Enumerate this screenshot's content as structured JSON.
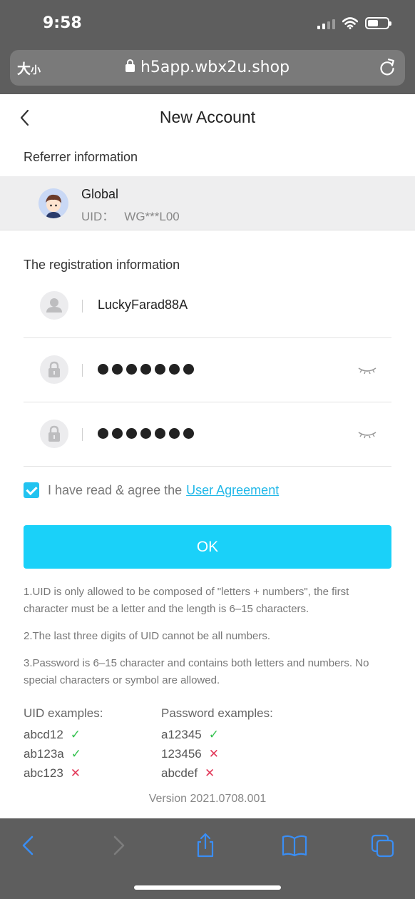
{
  "status_bar": {
    "time": "9:58"
  },
  "browser": {
    "text_size_label": "大",
    "text_size_small": "小",
    "url": "h5app.wbx2u.shop"
  },
  "header": {
    "title": "New Account"
  },
  "referrer": {
    "section_label": "Referrer information",
    "name": "Global",
    "uid_label": "UID：",
    "uid_value": "WG***L00"
  },
  "registration": {
    "section_label": "The registration information",
    "username_value": "LuckyFarad88A",
    "password_mask_count": 7,
    "confirm_mask_count": 7
  },
  "agreement": {
    "text": "I have read & agree the",
    "link": "User Agreement",
    "checked": true
  },
  "submit": {
    "label": "OK"
  },
  "rules": [
    "1.UID is only allowed to be composed of \"letters + numbers\", the first character must be a letter and the length is 6–15 characters.",
    "2.The last three digits of UID cannot be all numbers.",
    "3.Password is 6–15 character and contains both letters and numbers. No special characters or symbol are allowed."
  ],
  "uid_examples": {
    "title": "UID examples:",
    "items": [
      {
        "value": "abcd12",
        "valid": true
      },
      {
        "value": "ab123a",
        "valid": true
      },
      {
        "value": "abc123",
        "valid": false
      }
    ]
  },
  "password_examples": {
    "title": "Password examples:",
    "items": [
      {
        "value": "a12345",
        "valid": true
      },
      {
        "value": "123456",
        "valid": false
      },
      {
        "value": "abcdef",
        "valid": false
      }
    ]
  },
  "version": "Version 2021.0708.001",
  "colors": {
    "accent": "#1ad1f9",
    "link": "#22b8e8",
    "valid": "#34c24f",
    "invalid": "#e23a5a"
  }
}
